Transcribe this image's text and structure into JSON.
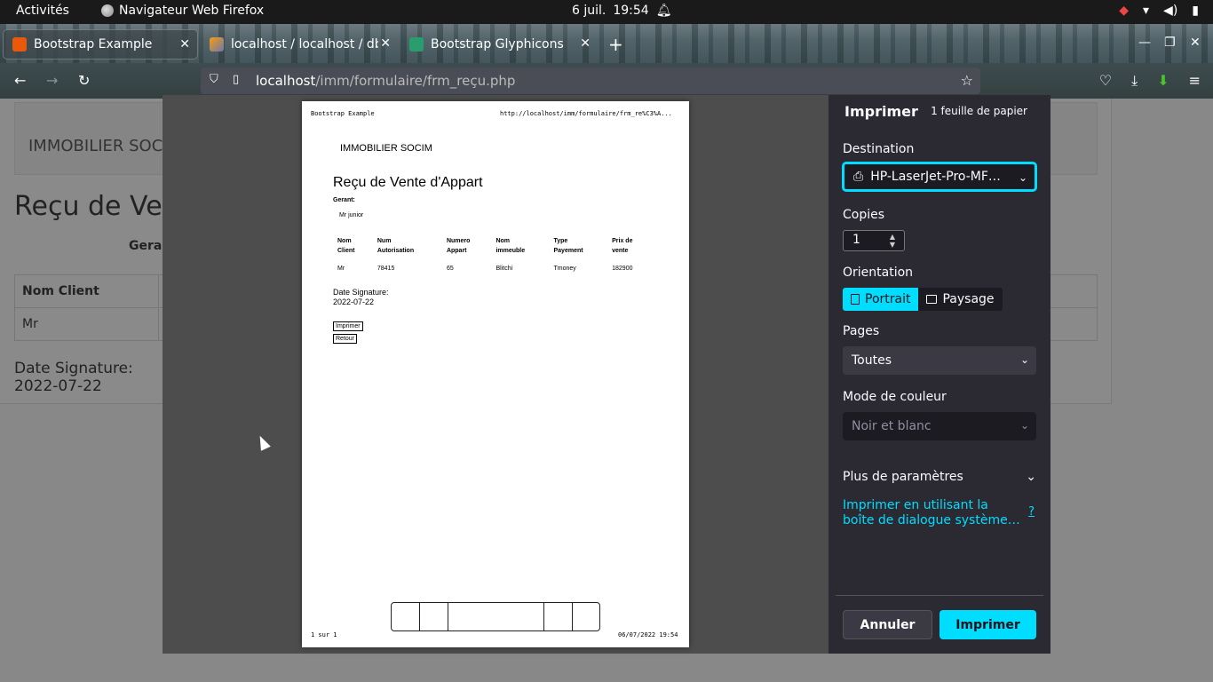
{
  "system_bar": {
    "activities": "Activités",
    "app_name": "Navigateur Web Firefox",
    "date": "6 juil.",
    "time": "19:54"
  },
  "tabs": [
    {
      "title": "Bootstrap Example",
      "active": true
    },
    {
      "title": "localhost / localhost / db",
      "active": false
    },
    {
      "title": "Bootstrap Glyphicons",
      "active": false
    }
  ],
  "url": {
    "host": "localhost",
    "path": "/imm/formulaire/frm_reçu.php"
  },
  "page": {
    "brand": "IMMOBILIER SOC",
    "heading": "Reçu de Ven",
    "gerant_label": "Geran",
    "table_header": "Nom Client",
    "table_cell": "Mr",
    "date_label": "Date Signature:",
    "date_value": "2022-07-22"
  },
  "preview": {
    "header_left": "Bootstrap Example",
    "header_right": "http://localhost/imm/formulaire/frm_re%C3%A...",
    "brand": "IMMOBILIER SOCIM",
    "title": "Reçu de Vente d'Appart",
    "gerant_label": "Gerant:",
    "gerant_value": "Mr junior",
    "columns": [
      [
        "Nom",
        "Client"
      ],
      [
        "Num",
        "Autorisation"
      ],
      [
        "Numero",
        "Appart"
      ],
      [
        "Nom",
        "immeuble"
      ],
      [
        "Type",
        "Payement"
      ],
      [
        "Prix de",
        "vente"
      ]
    ],
    "row": [
      "Mr",
      "78415",
      "65",
      "Blitchi",
      "Tmoney",
      "182900"
    ],
    "date_label": "Date Signature:",
    "date_value": "2022-07-22",
    "btn_print": "Imprimer",
    "btn_back": "Retour",
    "footer_left": "1 sur 1",
    "footer_right": "06/07/2022 19:54"
  },
  "print_panel": {
    "title": "Imprimer",
    "sheets": "1 feuille de papier",
    "destination_label": "Destination",
    "destination_value": "HP-LaserJet-Pro-MF…",
    "copies_label": "Copies",
    "copies_value": "1",
    "orientation_label": "Orientation",
    "portrait": "Portrait",
    "landscape": "Paysage",
    "pages_label": "Pages",
    "pages_value": "Toutes",
    "color_label": "Mode de couleur",
    "color_value": "Noir et blanc",
    "more_settings": "Plus de paramètres",
    "system_dialog": "Imprimer en utilisant la boîte de dialogue système…",
    "help": "?",
    "cancel": "Annuler",
    "print": "Imprimer"
  },
  "colors": {
    "accent": "#00ddff",
    "panel_bg": "#2b2a33",
    "select_bg": "#1c1b22"
  }
}
